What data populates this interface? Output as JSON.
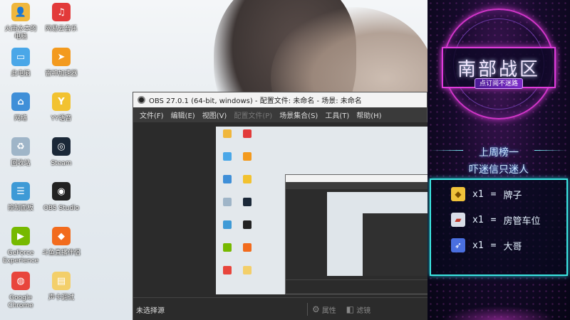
{
  "desktop": {
    "icons": [
      {
        "label": "火雨水本的\n电脑",
        "icon": "user-folder-icon",
        "color": "#f0b73c"
      },
      {
        "label": "网易云音乐",
        "icon": "netease-music-icon",
        "color": "#e23a3a"
      },
      {
        "label": "此电脑",
        "icon": "computer-icon",
        "color": "#4aa7e8"
      },
      {
        "label": "雷神加速器",
        "icon": "accelerator-icon",
        "color": "#f39a1e"
      },
      {
        "label": "网络",
        "icon": "network-icon",
        "color": "#3f8fd8"
      },
      {
        "label": "YY语音",
        "icon": "yy-voice-icon",
        "color": "#f2c230"
      },
      {
        "label": "回收站",
        "icon": "recycle-bin-icon",
        "color": "#9fb5c8"
      },
      {
        "label": "Steam",
        "icon": "steam-icon",
        "color": "#1b2838"
      },
      {
        "label": "控制面板",
        "icon": "control-panel-icon",
        "color": "#3e9ad6"
      },
      {
        "label": "OBS Studio",
        "icon": "obs-icon",
        "color": "#222222"
      },
      {
        "label": "GeForce\nExperience",
        "icon": "geforce-icon",
        "color": "#76b900"
      },
      {
        "label": "斗鱼直播伴侣",
        "icon": "douyu-icon",
        "color": "#f26b1d"
      },
      {
        "label": "Google\nChrome",
        "icon": "chrome-icon",
        "color": "#e8453c"
      },
      {
        "label": "声卡调试",
        "icon": "folder-icon",
        "color": "#f3cf6a"
      }
    ]
  },
  "obs": {
    "title": "OBS 27.0.1 (64-bit, windows) - 配置文件: 未命名 - 场景: 未命名",
    "menu": [
      "文件(F)",
      "编辑(E)",
      "视图(V)",
      "配置文件(P)",
      "场景集合(S)",
      "工具(T)",
      "帮助(H)"
    ],
    "footer": {
      "no_source": "未选择源",
      "properties": "属性",
      "filters": "滤镜"
    }
  },
  "panel": {
    "emblem_title": "南部战区",
    "emblem_sub": "点订阅不迷路",
    "rank_title": "上周榜一",
    "rank_name": "吓迷信只迷人",
    "gifts": [
      {
        "qty": "x1",
        "eq": "=",
        "name": "牌子",
        "icon": "badge-icon",
        "color": "#f0c23a"
      },
      {
        "qty": "x1",
        "eq": "=",
        "name": "房管车位",
        "icon": "car-icon",
        "color": "#d9dde8"
      },
      {
        "qty": "x1",
        "eq": "=",
        "name": "大哥",
        "icon": "rocket-icon",
        "color": "#4a6fe0"
      }
    ],
    "colors": {
      "accent": "#e03bdc",
      "frame": "#3ce6e2"
    }
  }
}
